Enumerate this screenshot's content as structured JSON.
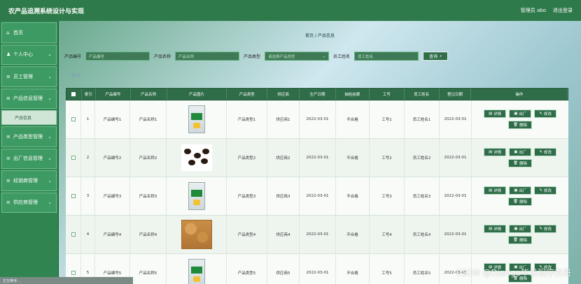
{
  "app": {
    "title": "农产品追溯系统设计与实现",
    "user": "管理员 abo",
    "logout": "退出登录"
  },
  "sidebar": {
    "items": [
      {
        "label": "首页",
        "icon": "home-icon"
      },
      {
        "label": "个人中心",
        "icon": "user-icon"
      },
      {
        "label": "员工管理",
        "icon": "menu-icon"
      },
      {
        "label": "产品信息管理",
        "icon": "menu-icon"
      },
      {
        "label": "产品类型管理",
        "icon": "menu-icon"
      },
      {
        "label": "出厂信息管理",
        "icon": "menu-icon"
      },
      {
        "label": "经销商管理",
        "icon": "menu-icon"
      },
      {
        "label": "供应商管理",
        "icon": "menu-icon"
      }
    ],
    "sub_item": "产品信息"
  },
  "breadcrumb": {
    "home": "首页",
    "sep": "/",
    "current": "产品信息"
  },
  "search": {
    "code_label": "产品编号",
    "code_placeholder": "产品编号",
    "name_label": "产品名称",
    "name_placeholder": "产品名称",
    "type_label": "产品类型",
    "type_placeholder": "请选择产品类型",
    "emp_label": "员工姓名",
    "emp_placeholder": "员工姓名",
    "button": "查询"
  },
  "actions": {
    "delete": "删除"
  },
  "table": {
    "headers": [
      "索引",
      "产品编号",
      "产品名称",
      "产品图片",
      "产品类型",
      "供应商",
      "生产日期",
      "抽检结果",
      "工号",
      "员工姓名",
      "登记日期",
      "操作"
    ],
    "rows": [
      {
        "idx": "1",
        "code": "产品编号1",
        "name": "产品名称1",
        "img": "bag",
        "type": "产品类型1",
        "sup": "供应商1",
        "date": "2022-03-01",
        "res": "不合格",
        "no": "工号1",
        "emp": "员工姓名1",
        "reg": "2022-03-01"
      },
      {
        "idx": "2",
        "code": "产品编号2",
        "name": "产品名称2",
        "img": "seeds",
        "type": "产品类型2",
        "sup": "供应商2",
        "date": "2022-03-01",
        "res": "不合格",
        "no": "工号2",
        "emp": "员工姓名2",
        "reg": "2022-03-01"
      },
      {
        "idx": "3",
        "code": "产品编号3",
        "name": "产品名称3",
        "img": "bag",
        "type": "产品类型3",
        "sup": "供应商3",
        "date": "2022-03-01",
        "res": "不合格",
        "no": "工号3",
        "emp": "员工姓名3",
        "reg": "2022-03-01"
      },
      {
        "idx": "4",
        "code": "产品编号4",
        "name": "产品名称4",
        "img": "grain",
        "type": "产品类型4",
        "sup": "供应商4",
        "date": "2022-03-01",
        "res": "不合格",
        "no": "工号4",
        "emp": "员工姓名4",
        "reg": "2022-03-01"
      },
      {
        "idx": "5",
        "code": "产品编号5",
        "name": "产品名称5",
        "img": "bag",
        "type": "产品类型5",
        "sup": "供应商5",
        "date": "2022-03-01",
        "res": "不合格",
        "no": "工号5",
        "emp": "员工姓名5",
        "reg": "2022-03-01"
      }
    ],
    "ops": {
      "detail": "详情",
      "ship": "出厂",
      "edit": "修改",
      "delete": "删除"
    }
  },
  "watermark": "CSDN @Django毕设程序杰哥",
  "status_bar": "正在等待..."
}
